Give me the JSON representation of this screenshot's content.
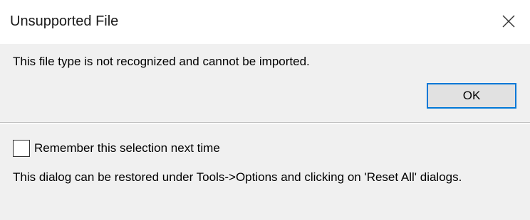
{
  "dialog": {
    "title": "Unsupported File",
    "close_icon": "close-icon",
    "message": "This file type is not recognized and cannot be imported.",
    "ok_label": "OK",
    "remember": {
      "label": "Remember this selection next time",
      "checked": false
    },
    "restore_note": "This dialog can be restored under Tools->Options and clicking on 'Reset All' dialogs."
  },
  "colors": {
    "panel_background": "#f0f0f0",
    "title_background": "#ffffff",
    "default_button_border": "#0078d7",
    "button_background": "#e1e1e1"
  }
}
